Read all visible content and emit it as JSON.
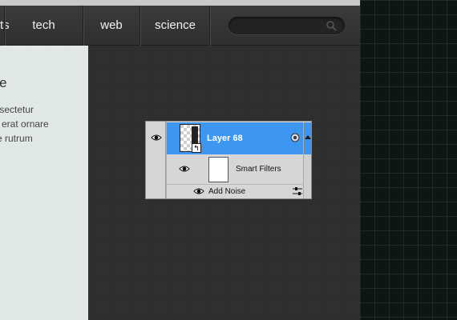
{
  "nav": {
    "items": [
      {
        "label": "rts"
      },
      {
        "label": "tech"
      },
      {
        "label": "web"
      },
      {
        "label": "science"
      }
    ],
    "search": {
      "value": "",
      "placeholder": "",
      "icon": "search-icon"
    }
  },
  "content": {
    "heading": "ere",
    "lines": [
      "onsectetur",
      "ec erat ornare",
      "nte rutrum"
    ]
  },
  "layers_panel": {
    "layer_name": "Layer 68",
    "smart_filters_label": "Smart Filters",
    "filter_name": "Add Noise",
    "selected_color": "#3d96f0"
  }
}
